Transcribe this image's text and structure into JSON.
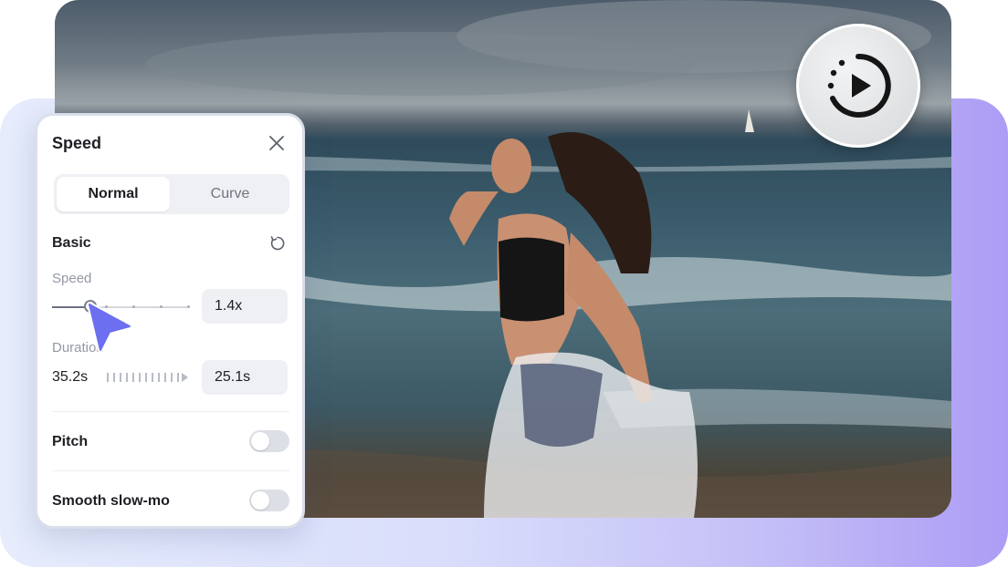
{
  "panel": {
    "title": "Speed",
    "tabs": [
      {
        "label": "Normal",
        "active": true
      },
      {
        "label": "Curve",
        "active": false
      }
    ],
    "section_title": "Basic",
    "speed": {
      "label": "Speed",
      "value": "1.4x",
      "slider_fraction": 0.28
    },
    "duration": {
      "label": "Duration",
      "original": "35.2s",
      "new": "25.1s"
    },
    "pitch": {
      "label": "Pitch",
      "enabled": false
    },
    "smooth": {
      "label": "Smooth slow-mo",
      "enabled": false
    }
  },
  "icons": {
    "close": "close-icon",
    "reset": "reset-icon",
    "replay": "replay-play-icon",
    "cursor": "mouse-pointer-icon"
  },
  "colors": {
    "accent": "#6c6ff0",
    "backdrop_start": "#e6ecfc",
    "backdrop_end": "#ad9cf5"
  }
}
